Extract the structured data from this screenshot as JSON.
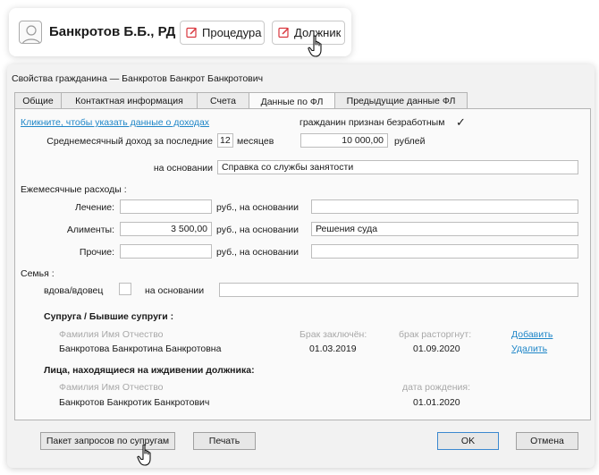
{
  "card": {
    "title": "Банкротов Б.Б., РД",
    "buttons": [
      {
        "label": "Процедура",
        "icon": "edit-icon"
      },
      {
        "label": "Должник",
        "icon": "edit-icon"
      }
    ]
  },
  "window": {
    "title": "Свойства гражданина — Банкротов Банкрот Банкротович",
    "tabs": [
      "Общие",
      "Контактная информация",
      "Счета",
      "Данные по ФЛ",
      "Предыдущие данные ФЛ"
    ],
    "active_tab": "Данные по ФЛ"
  },
  "income": {
    "link": "Кликните, чтобы указать данные о доходах",
    "unemployed_label": "гражданин признан безработным",
    "unemployed_checked": "✓",
    "avg_label": "Среднемесячный доход за последние",
    "months_value": "12",
    "months_label": "месяцев",
    "amount_value": "10 000,00",
    "currency_label": "рублей",
    "basis_label": "на основании",
    "basis_value": "Справка со службы занятости"
  },
  "expenses": {
    "heading": "Ежемесячные расходы :",
    "rows": [
      {
        "label": "Лечение:",
        "value": "",
        "unit": "руб., на основании",
        "basis": ""
      },
      {
        "label": "Алименты:",
        "value": "3 500,00",
        "unit": "руб., на основании",
        "basis": "Решения суда"
      },
      {
        "label": "Прочие:",
        "value": "",
        "unit": "руб., на основании",
        "basis": ""
      }
    ]
  },
  "family": {
    "heading": "Семья :",
    "widow_label": "вдова/вдовец",
    "basis_label": "на основании",
    "basis_value": ""
  },
  "spouses": {
    "heading": "Супруга / Бывшие супруги :",
    "col_name": "Фамилия Имя Отчество",
    "col_married": "Брак заключён:",
    "col_divorced": "брак расторгнут:",
    "add_link": "Добавить",
    "delete_link": "Удалить",
    "rows": [
      {
        "name": "Банкротова Банкротина Банкротовна",
        "married": "01.03.2019",
        "divorced": "01.09.2020"
      }
    ]
  },
  "dependents": {
    "heading": "Лица, находящиеся на иждивении должника:",
    "col_name": "Фамилия Имя Отчество",
    "col_birth": "дата рождения:",
    "rows": [
      {
        "name": "Банкротов Банкротик Банкротович",
        "birth": "01.01.2020"
      }
    ]
  },
  "footer": {
    "request_button": "Пакет запросов по супругам",
    "print_button": "Печать",
    "ok_button": "OK",
    "cancel_button": "Отмена"
  },
  "colors": {
    "accent": "#1f86c8",
    "edit_icon": "#d9363e",
    "ok_border": "#3b88cf"
  }
}
